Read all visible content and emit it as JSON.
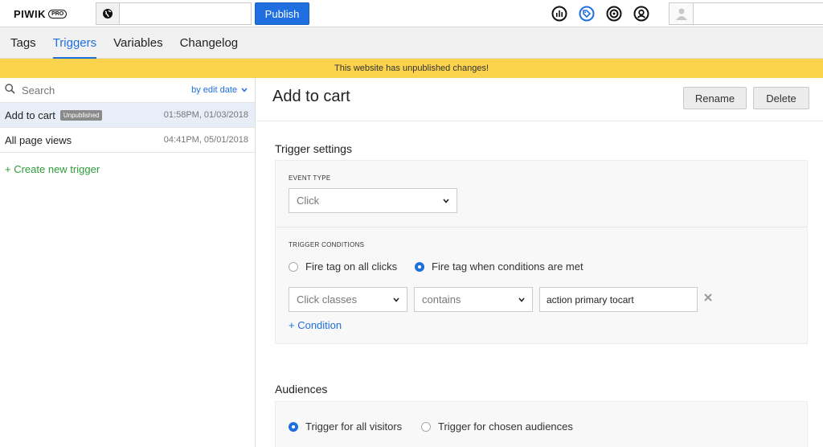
{
  "app": {
    "logo_text": "PIWIK",
    "logo_badge": "PRO",
    "publish_label": "Publish"
  },
  "nav": {
    "tabs": [
      {
        "label": "Tags"
      },
      {
        "label": "Triggers"
      },
      {
        "label": "Variables"
      },
      {
        "label": "Changelog"
      }
    ]
  },
  "banner": {
    "text": "This website has unpublished changes!"
  },
  "sidebar": {
    "search_placeholder": "Search",
    "sort_label": "by edit date",
    "triggers": [
      {
        "name": "Add to cart",
        "badge": "Unpublished",
        "date": "01:58PM, 01/03/2018"
      },
      {
        "name": "All page views",
        "badge": "",
        "date": "04:41PM, 05/01/2018"
      }
    ],
    "create_label": "+ Create new trigger"
  },
  "main": {
    "title": "Add to cart",
    "rename_label": "Rename",
    "delete_label": "Delete",
    "trigger_settings_title": "Trigger settings",
    "event_type_label": "EVENT TYPE",
    "event_type_value": "Click",
    "trigger_conditions_label": "TRIGGER CONDITIONS",
    "radio_all_clicks": "Fire tag on all clicks",
    "radio_conditions": "Fire tag when conditions are met",
    "condition": {
      "variable": "Click classes",
      "operator": "contains",
      "value": "action primary tocart"
    },
    "add_condition_label": "+ Condition",
    "audiences_title": "Audiences",
    "radio_all_visitors": "Trigger for all visitors",
    "radio_chosen_audiences": "Trigger for chosen audiences"
  },
  "colors": {
    "accent": "#1f6fe0",
    "banner": "#fcd34d",
    "create_link": "#2e9b3a"
  },
  "icons": [
    "globe-icon",
    "reports-icon",
    "tag-manager-icon",
    "audience-icon",
    "account-icon",
    "user-avatar-icon",
    "search-icon",
    "chevron-down-icon",
    "close-icon"
  ]
}
